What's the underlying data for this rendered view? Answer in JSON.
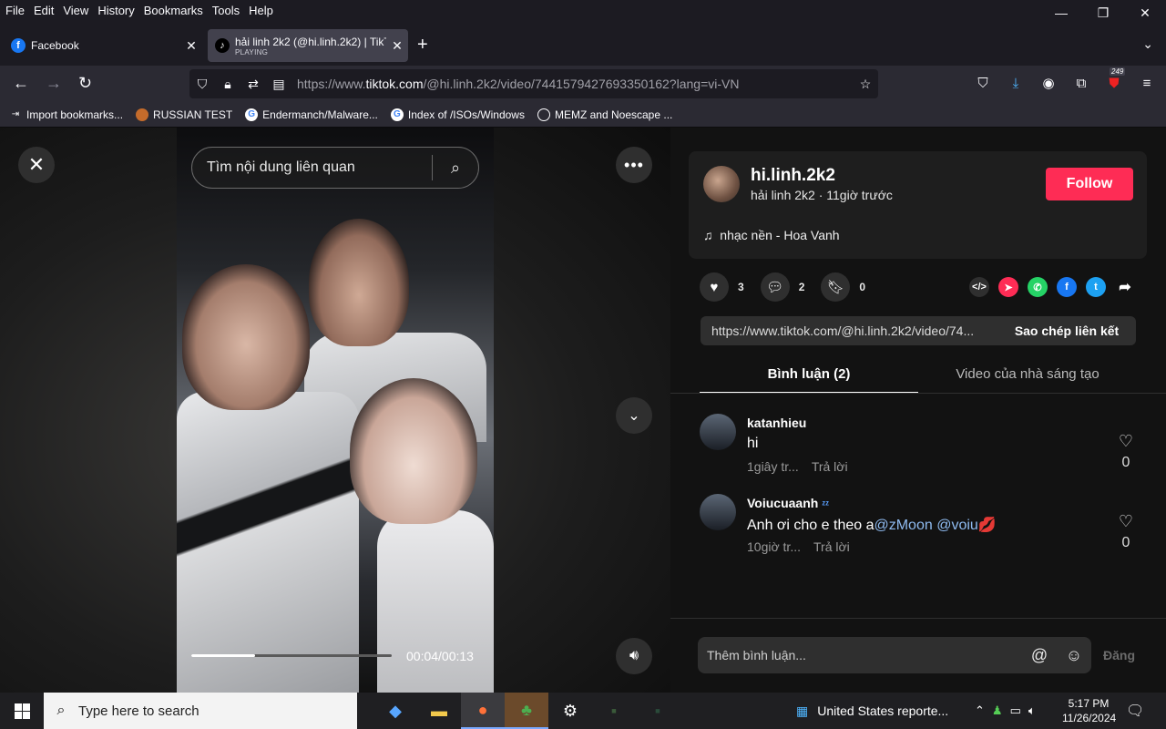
{
  "menu": [
    "File",
    "Edit",
    "View",
    "History",
    "Bookmarks",
    "Tools",
    "Help"
  ],
  "window_controls": {
    "minimize": "—",
    "restore": "❐",
    "close": "✕"
  },
  "tabs": [
    {
      "title": "Facebook",
      "icon": "facebook-icon"
    },
    {
      "title": "hải linh 2k2 (@hi.linh.2k2) | TikT",
      "subtitle": "PLAYING",
      "icon": "tiktok-icon"
    }
  ],
  "new_tab": "+",
  "url": {
    "prefix": "https://www.",
    "domain": "tiktok.com",
    "path": "/@hi.linh.2k2/video/7441579427693350162?lang=vi-VN"
  },
  "toolbar_badge": "249",
  "bookmarks": [
    {
      "label": "Import bookmarks...",
      "icon": "import-icon"
    },
    {
      "label": "RUSSIAN TEST",
      "icon": "github-icon"
    },
    {
      "label": "Endermanch/Malware...",
      "icon": "google-icon"
    },
    {
      "label": "Index of /ISOs/Windows",
      "icon": "google-icon"
    },
    {
      "label": "MEMZ and Noescape ...",
      "icon": "globe-icon"
    }
  ],
  "video": {
    "search_placeholder": "Tìm nội dung liên quan",
    "time": "00:04/00:13",
    "progress": 0.32
  },
  "author": {
    "username": "hi.linh.2k2",
    "meta": "hải linh 2k2 · 11giờ trước",
    "follow_label": "Follow",
    "music": "nhạc nền - Hoa Vanh"
  },
  "stats": {
    "likes": "3",
    "comments": "2",
    "saves": "0"
  },
  "link": {
    "url": "https://www.tiktok.com/@hi.linh.2k2/video/74...",
    "copy_label": "Sao chép liên kết"
  },
  "panel_tabs": {
    "comments": "Bình luận (2)",
    "creator_videos": "Video của nhà sáng tạo"
  },
  "comments": [
    {
      "user": "katanhieu",
      "text": "hi",
      "time": "1giây tr...",
      "reply": "Trả lời",
      "likes": "0"
    },
    {
      "user": "Voiucuaanh",
      "badge": "ᶻᶻ",
      "text_plain": "Anh ơi cho e theo a",
      "mention1": "@zMoon",
      "mention2": "@voiu",
      "emoji": "💋",
      "time": "10giờ tr...",
      "reply": "Trả lời",
      "likes": "0"
    }
  ],
  "comment_input": {
    "placeholder": "Thêm bình luận...",
    "post_label": "Đăng"
  },
  "taskbar": {
    "search_placeholder": "Type here to search",
    "news": "United States reporte...",
    "time": "5:17 PM",
    "date": "11/26/2024"
  },
  "colors": {
    "accent": "#fe2c55",
    "mention": "#8fbbf0"
  }
}
